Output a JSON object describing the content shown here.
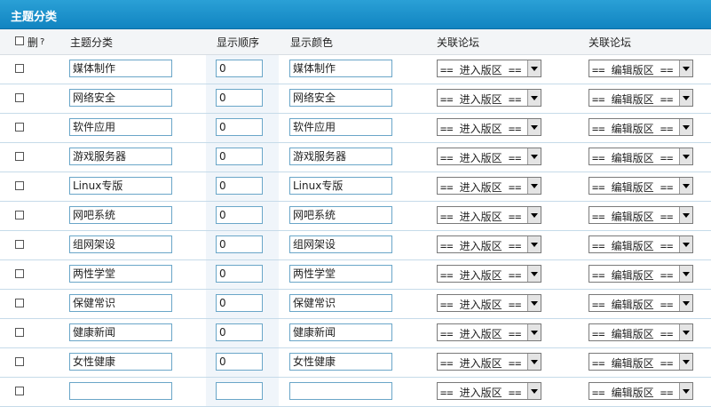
{
  "title": "主题分类",
  "header": {
    "delete": "删",
    "help": "?",
    "name": "主题分类",
    "order": "显示顺序",
    "color": "显示颜色",
    "forum1": "关联论坛",
    "forum2": "关联论坛"
  },
  "rows": [
    {
      "name": "媒体制作",
      "order": "0",
      "color": "媒体制作",
      "forum_enter": "== 进入版区 ==",
      "forum_edit": "== 编辑版区 =="
    },
    {
      "name": "网络安全",
      "order": "0",
      "color": "网络安全",
      "forum_enter": "== 进入版区 ==",
      "forum_edit": "== 编辑版区 =="
    },
    {
      "name": "软件应用",
      "order": "0",
      "color": "软件应用",
      "forum_enter": "== 进入版区 ==",
      "forum_edit": "== 编辑版区 =="
    },
    {
      "name": "游戏服务器",
      "order": "0",
      "color": "游戏服务器",
      "forum_enter": "== 进入版区 ==",
      "forum_edit": "== 编辑版区 =="
    },
    {
      "name": "Linux专版",
      "order": "0",
      "color": "Linux专版",
      "forum_enter": "== 进入版区 ==",
      "forum_edit": "== 编辑版区 =="
    },
    {
      "name": "网吧系统",
      "order": "0",
      "color": "网吧系统",
      "forum_enter": "== 进入版区 ==",
      "forum_edit": "== 编辑版区 =="
    },
    {
      "name": "组网架设",
      "order": "0",
      "color": "组网架设",
      "forum_enter": "== 进入版区 ==",
      "forum_edit": "== 编辑版区 =="
    },
    {
      "name": "两性学堂",
      "order": "0",
      "color": "两性学堂",
      "forum_enter": "== 进入版区 ==",
      "forum_edit": "== 编辑版区 =="
    },
    {
      "name": "保健常识",
      "order": "0",
      "color": "保健常识",
      "forum_enter": "== 进入版区 ==",
      "forum_edit": "== 编辑版区 =="
    },
    {
      "name": "健康新闻",
      "order": "0",
      "color": "健康新闻",
      "forum_enter": "== 进入版区 ==",
      "forum_edit": "== 编辑版区 =="
    },
    {
      "name": "女性健康",
      "order": "0",
      "color": "女性健康",
      "forum_enter": "== 进入版区 ==",
      "forum_edit": "== 编辑版区 =="
    },
    {
      "name": "",
      "order": "",
      "color": "",
      "forum_enter": "== 进入版区 ==",
      "forum_edit": "== 编辑版区 =="
    }
  ]
}
